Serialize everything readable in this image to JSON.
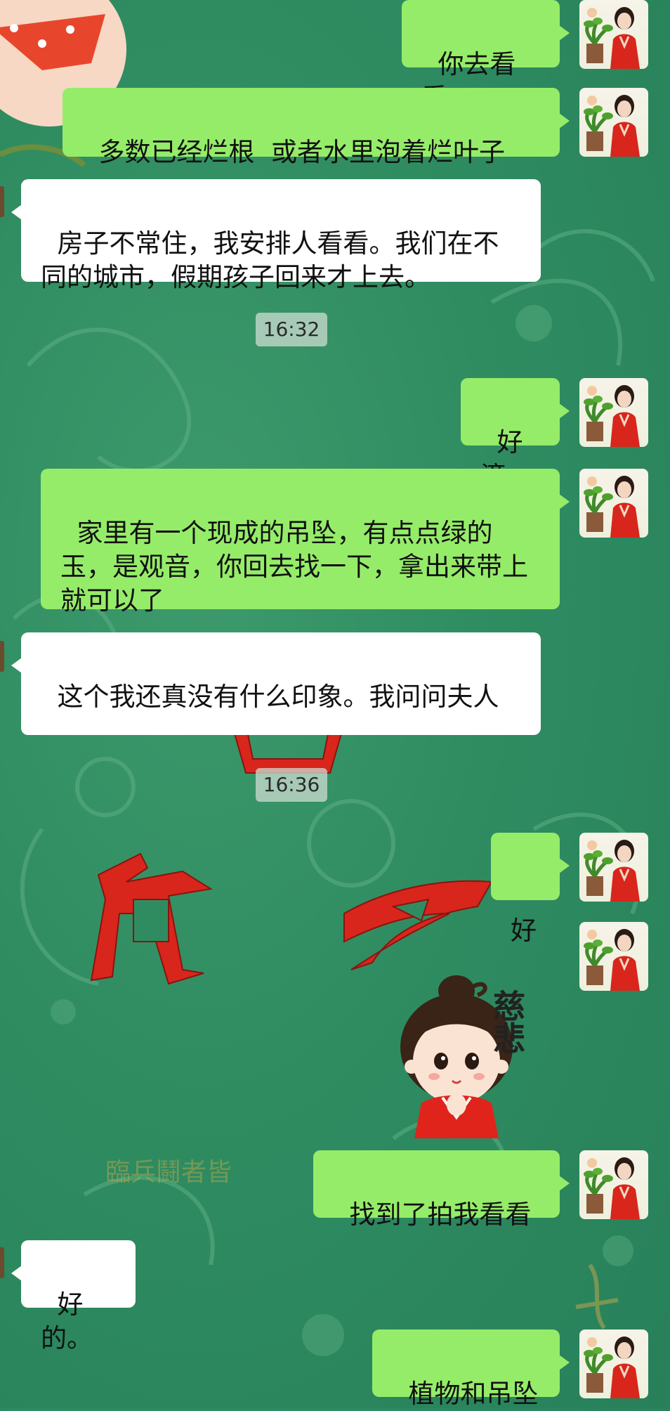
{
  "messages": [
    {
      "side": "out",
      "text": "你去看看"
    },
    {
      "side": "out",
      "text": "多数已经烂根  或者水里泡着烂叶子"
    },
    {
      "side": "in",
      "text": "房子不常住，我安排人看看。我们在不同的城市，假期孩子回来才上去。"
    },
    {
      "side": "out",
      "text": "好滴"
    },
    {
      "side": "out",
      "text": "家里有一个现成的吊坠，有点点绿的玉，是观音，你回去找一下，拿出来带上就可以了"
    },
    {
      "side": "in",
      "text": "这个我还真没有什么印象。我问问夫人"
    },
    {
      "side": "out",
      "text": "好"
    },
    {
      "side": "out",
      "text": "找到了拍我看看"
    },
    {
      "side": "in",
      "text": "好的。"
    },
    {
      "side": "out",
      "text": "植物和吊坠"
    }
  ],
  "timestamps": [
    "16:32",
    "16:36"
  ],
  "sticker": {
    "text": "慈悲",
    "icon": "praying-girl-sticker"
  },
  "background": {
    "texts": [
      "臨兵鬪者皆"
    ],
    "colors": {
      "base": "#2f8c61",
      "accent_red": "#d8261c"
    }
  },
  "colors": {
    "bubble_out": "#95ec69",
    "bubble_in": "#ffffff",
    "timestamp_bg": "#cddcd2"
  },
  "icons": {
    "self_avatar": "woman-in-red-avatar"
  }
}
